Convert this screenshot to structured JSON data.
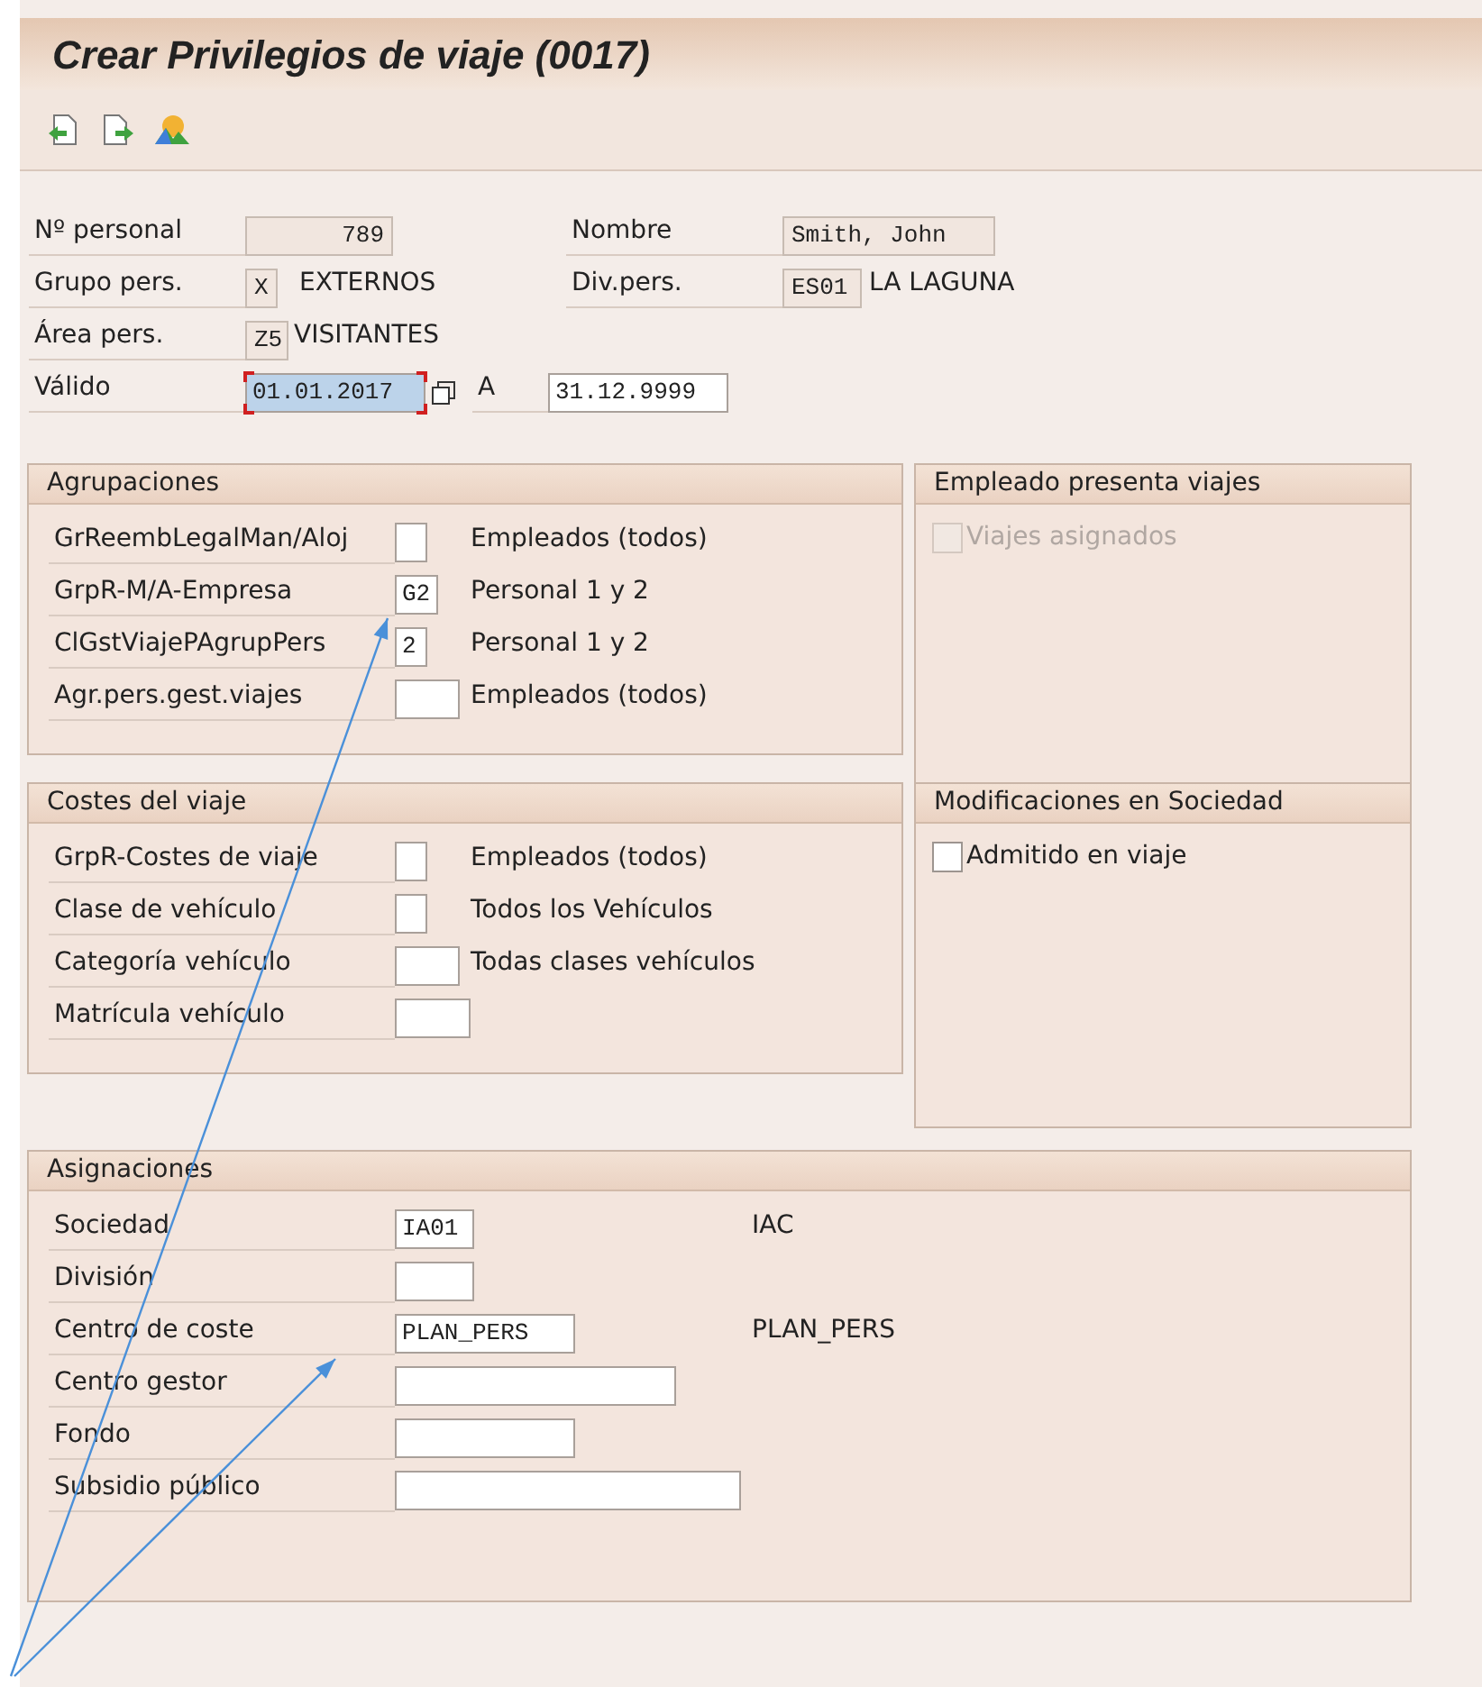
{
  "title": "Crear Privilegios de viaje (0017)",
  "header": {
    "personal": {
      "label": "Nº personal",
      "value": "789"
    },
    "nombre": {
      "label": "Nombre",
      "value": "Smith, John"
    },
    "grupo": {
      "label": "Grupo pers.",
      "value": "X",
      "text": "EXTERNOS"
    },
    "division": {
      "label": "Div.pers.",
      "value": "ES01",
      "text": "LA LAGUNA"
    },
    "area": {
      "label": "Área pers.",
      "value": "Z5",
      "text": "VISITANTES"
    },
    "valido": {
      "label": "Válido",
      "from": "01.01.2017",
      "focused": true,
      "to_label": "A",
      "to": "31.12.9999"
    }
  },
  "agrupaciones": {
    "title": "Agrupaciones",
    "fields": [
      {
        "label": "GrReembLegalMan/Aloj",
        "text": "Empleados (todos)"
      },
      {
        "label": "GrpR-M/A-Empresa",
        "value": "G2",
        "text": "Personal 1 y 2"
      },
      {
        "label": "ClGstViajePAgrupPers",
        "value": "2",
        "text": "Personal 1 y 2"
      },
      {
        "label": "Agr.pers.gest.viajes",
        "text": "Empleados (todos)"
      }
    ]
  },
  "empleado_presenta": {
    "title": "Empleado presenta viajes",
    "checkbox": {
      "label": "Viajes asignados",
      "checked": false,
      "disabled": true
    }
  },
  "costes": {
    "title": "Costes del viaje",
    "fields": [
      {
        "label": "GrpR-Costes de viaje",
        "text": "Empleados (todos)"
      },
      {
        "label": "Clase de vehículo",
        "text": "Todos los Vehículos"
      },
      {
        "label": "Categoría vehículo",
        "text": "Todas clases vehículos"
      },
      {
        "label": "Matrícula vehículo"
      }
    ]
  },
  "modificaciones": {
    "title": "Modificaciones en Sociedad",
    "checkbox": {
      "label": "Admitido en viaje",
      "checked": false,
      "disabled": false
    }
  },
  "asignaciones": {
    "title": "Asignaciones",
    "fields": [
      {
        "label": "Sociedad",
        "value": "IA01",
        "text": "IAC"
      },
      {
        "label": "División"
      },
      {
        "label": "Centro de coste",
        "value": "PLAN_PERS",
        "text": "PLAN_PERS"
      },
      {
        "label": "Centro gestor"
      },
      {
        "label": "Fondo"
      },
      {
        "label": "Subsidio público"
      }
    ]
  }
}
